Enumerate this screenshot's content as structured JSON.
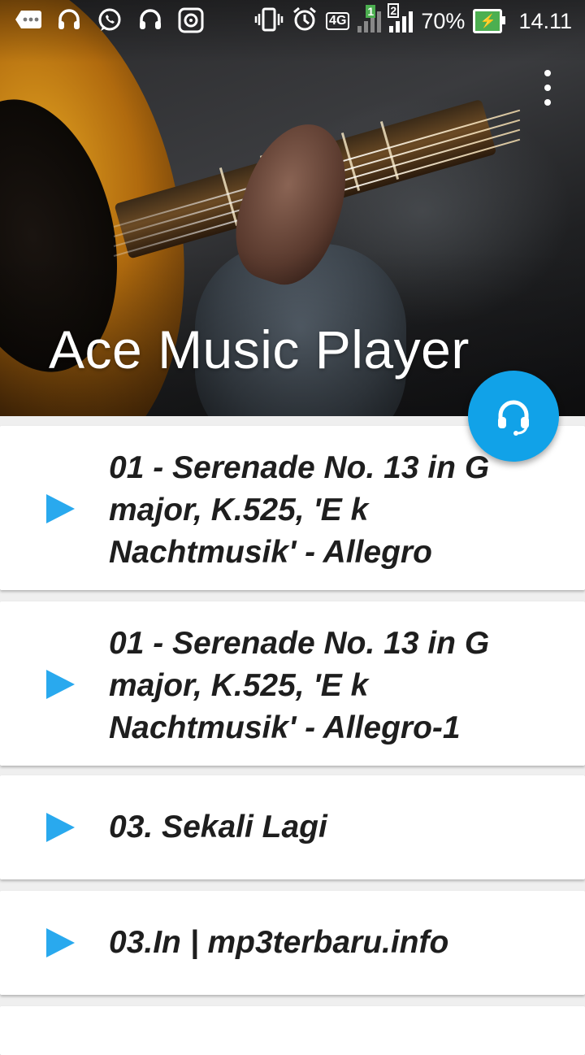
{
  "status_bar": {
    "network": "4G",
    "sim1": "1",
    "sim2": "2",
    "battery": "70%",
    "time": "14.11",
    "colors": {
      "battery_fill": "#4caf50"
    }
  },
  "header": {
    "title": "Ace Music Player",
    "menu_icon": "more-vert-icon"
  },
  "fab": {
    "icon": "headset-icon",
    "color": "#11a2e8"
  },
  "songs": [
    {
      "title": "01 - Serenade No. 13 in G major, K.525, 'E k Nachtmusik' - Allegro"
    },
    {
      "title": "01 - Serenade No. 13 in G major, K.525, 'E k Nachtmusik' - Allegro-1"
    },
    {
      "title": "03. Sekali Lagi"
    },
    {
      "title": "03.In | mp3terbaru.info"
    }
  ],
  "play_icon": {
    "name": "play-icon",
    "color": "#29a9ee"
  }
}
